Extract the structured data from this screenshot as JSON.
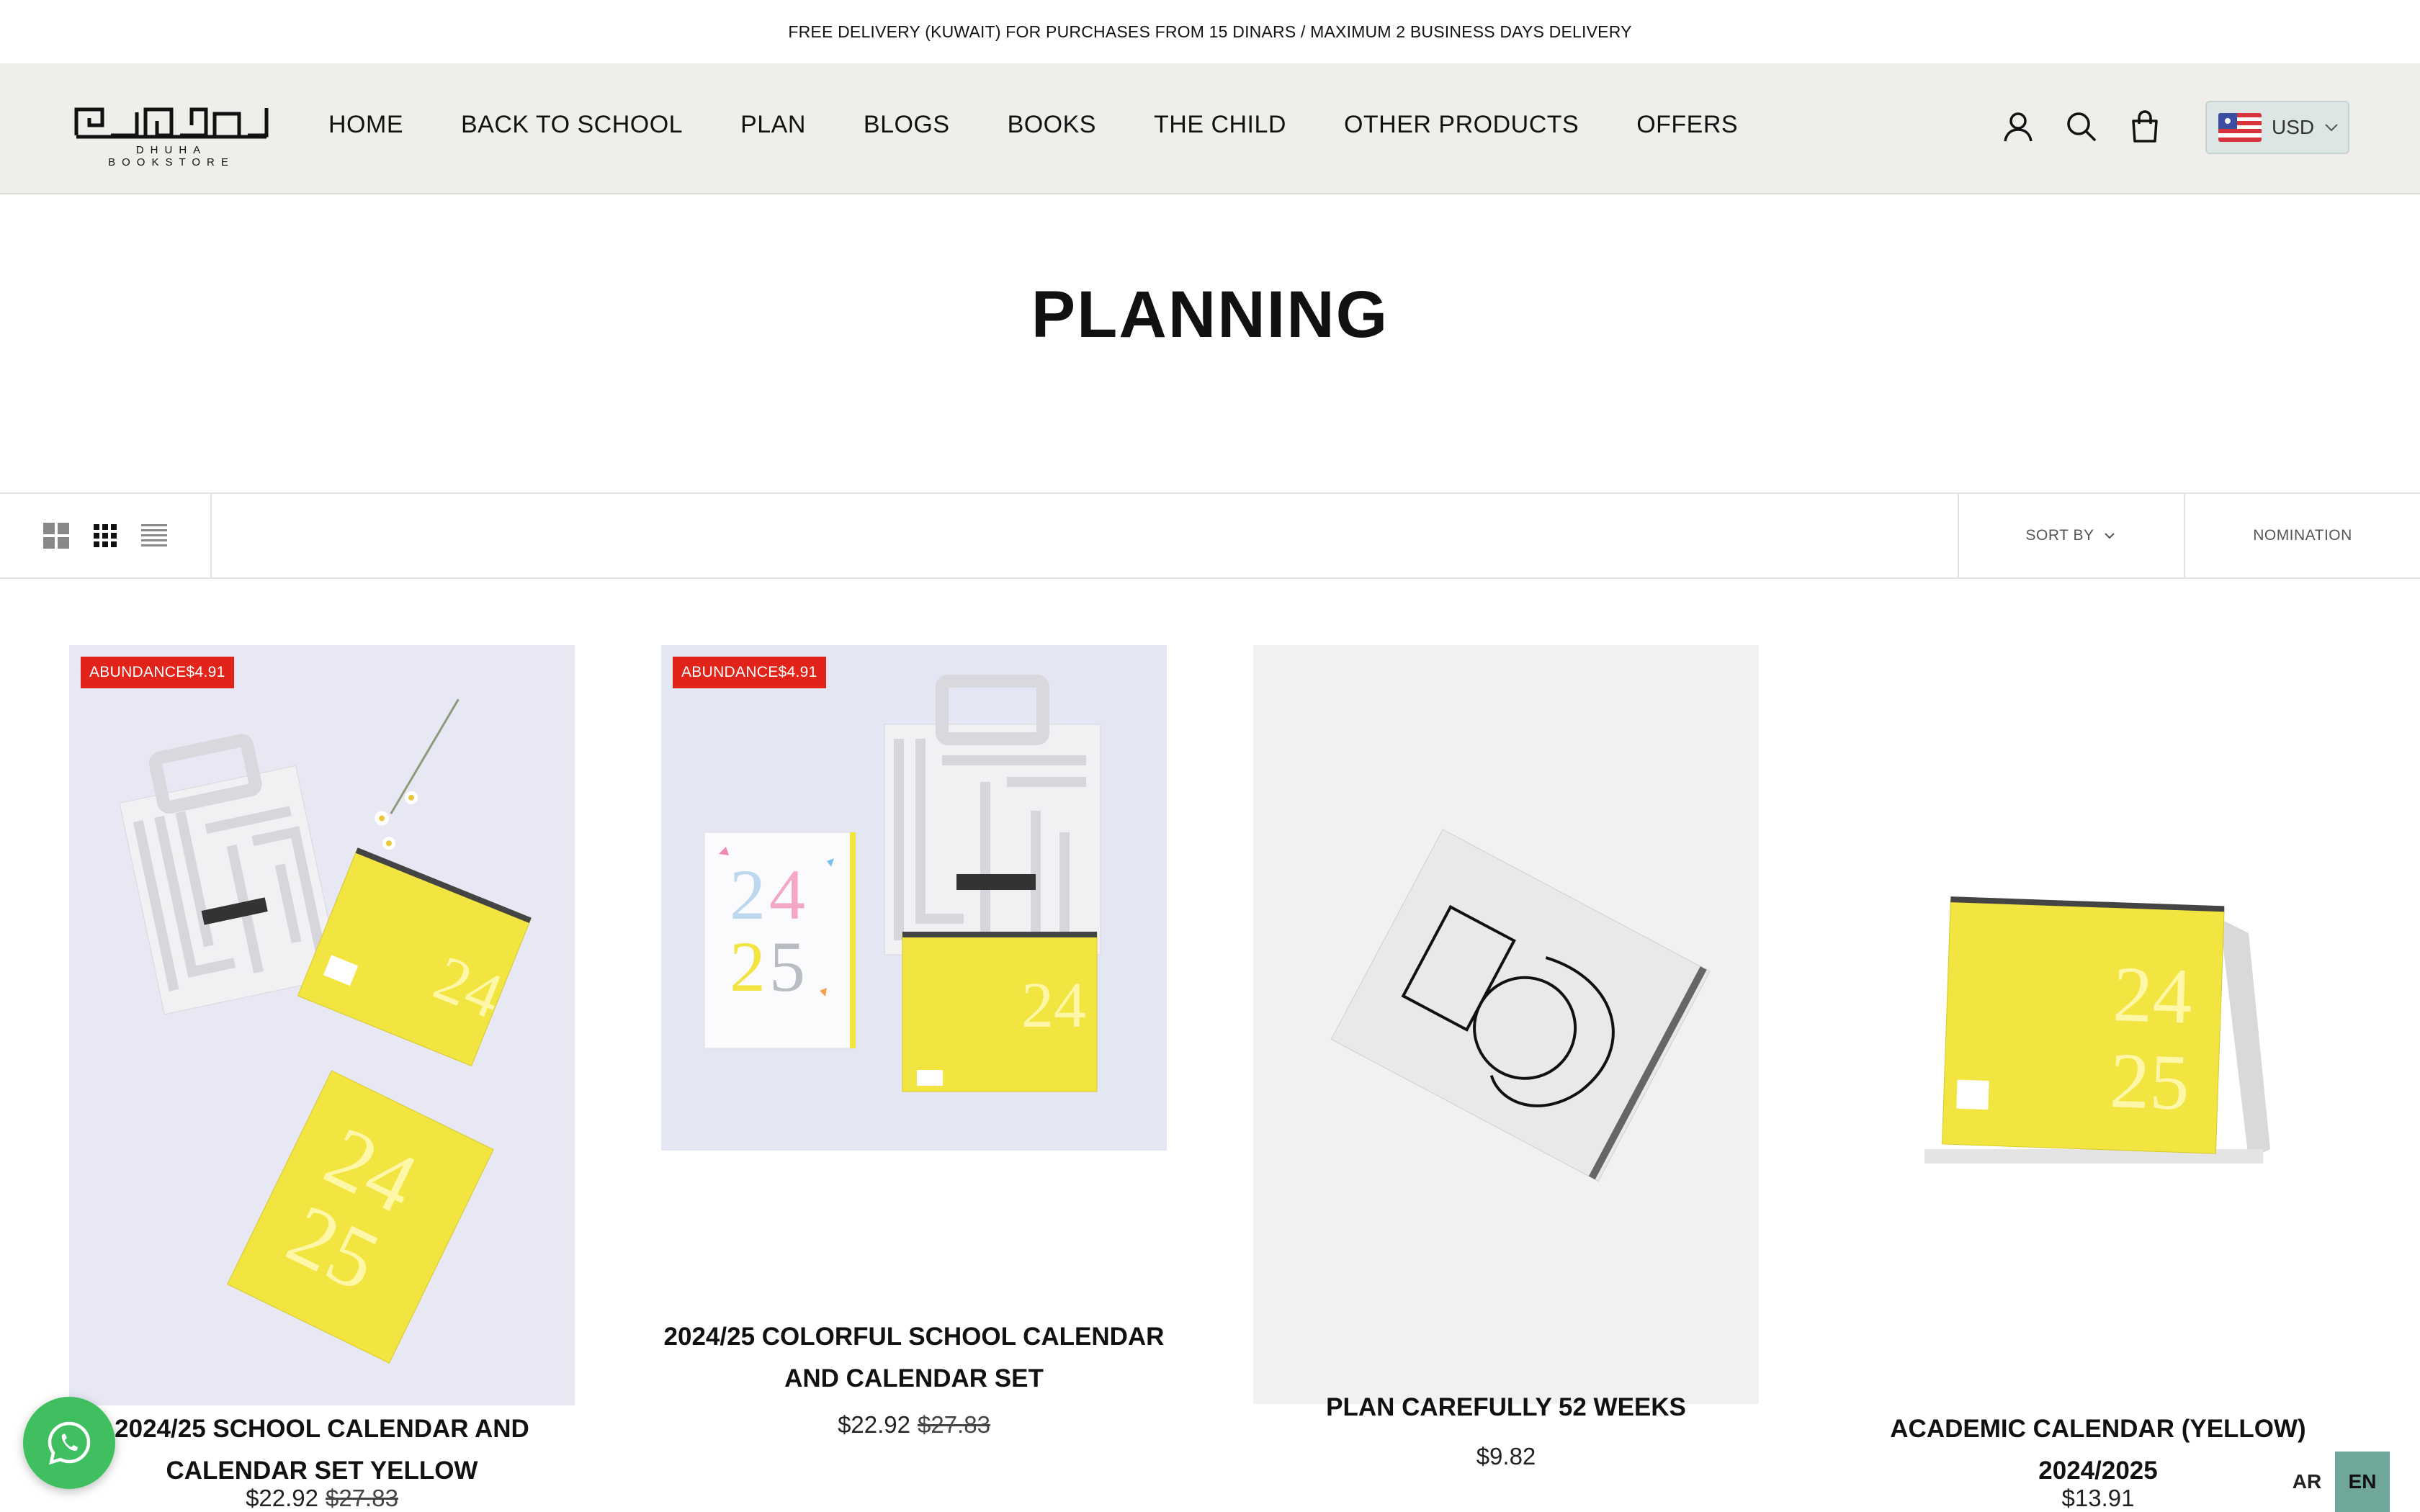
{
  "announcement": "FREE DELIVERY (KUWAIT) FOR PURCHASES FROM 15 DINARS / MAXIMUM 2 BUSINESS DAYS DELIVERY",
  "logo": {
    "text": "DHUHA BOOKSTORE"
  },
  "nav": [
    {
      "label": "HOME"
    },
    {
      "label": "BACK TO SCHOOL"
    },
    {
      "label": "PLAN"
    },
    {
      "label": "BLOGS"
    },
    {
      "label": "BOOKS"
    },
    {
      "label": "THE CHILD"
    },
    {
      "label": "OTHER PRODUCTS"
    },
    {
      "label": "OFFERS"
    }
  ],
  "header_icons": [
    "account-icon",
    "search-icon",
    "cart-icon"
  ],
  "currency": {
    "code": "USD",
    "flag": "us-flag-icon"
  },
  "page_title": "PLANNING",
  "toolbar": {
    "view_icons": [
      "grid-large-icon",
      "grid-small-icon",
      "list-icon"
    ],
    "sort_by": "SORT BY",
    "nomination": "NOMINATION"
  },
  "products": [
    {
      "badge": "ABUNDANCE$4.91",
      "title_line1": "2024/25 SCHOOL CALENDAR AND",
      "title_line2": "CALENDAR SET YELLOW",
      "price": "$22.92",
      "compare_price": "$27.83"
    },
    {
      "badge": "ABUNDANCE$4.91",
      "title_line1": "2024/25 COLORFUL SCHOOL CALENDAR",
      "title_line2": "AND CALENDAR SET",
      "price": "$22.92",
      "compare_price": "$27.83"
    },
    {
      "title_line1": "PLAN CAREFULLY 52 WEEKS",
      "price": "$9.82"
    },
    {
      "title_line1": "ACADEMIC CALENDAR (YELLOW)",
      "title_line2": "2024/2025",
      "price": "$13.91"
    }
  ],
  "language": {
    "ar": "AR",
    "en": "EN"
  },
  "colors": {
    "header_bg": "#efeeea",
    "badge": "#e2231a",
    "whatsapp": "#3fbf60",
    "lang_active": "#6fa89a",
    "product_yellow": "#f2e541"
  }
}
